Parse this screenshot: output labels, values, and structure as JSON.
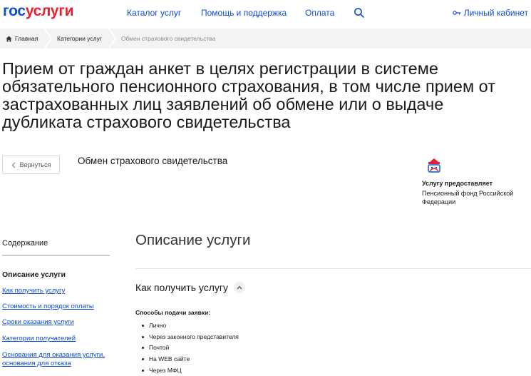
{
  "header": {
    "logo_part1": "гос",
    "logo_part2": "услуги",
    "nav": [
      "Каталог услуг",
      "Помощь и поддержка",
      "Оплата"
    ],
    "cabinet_label": "Личный кабинет"
  },
  "breadcrumb": {
    "home": "Главная",
    "category": "Категории услуг",
    "current": "Обмен страхового свидетельства"
  },
  "page": {
    "title": "Прием от граждан анкет в целях регистрации в системе обязательного пенсионного страхования, в том числе прием от застрахованных лиц заявлений об обмене или о выдаче дубликата страхового свидетельства",
    "back_label": "Вернуться",
    "service_name": "Обмен страхового свидетельства"
  },
  "provider": {
    "label": "Услугу предоставляет",
    "name": "Пенсионный фонд Российской Федерации"
  },
  "sidebar": {
    "title": "Содержание",
    "current": "Описание услуги",
    "links": [
      "Как получить услугу",
      "Стоимость и порядок оплаты",
      "Сроки оказания услуги",
      "Категории получателей",
      "Основания для оказания услуги, основания для отказа"
    ]
  },
  "main": {
    "section_title": "Описание услуги",
    "subsection_title": "Как получить услугу",
    "methods_label": "Способы подачи заявки:",
    "methods": [
      "Лично",
      "Через законного представителя",
      "Почтой",
      "На WEB сайте",
      "Через МФЦ"
    ]
  },
  "colors": {
    "brand_blue": "#0d4cd3",
    "brand_red": "#e4202a",
    "breadcrumb_bg": "#f2f3f5"
  },
  "icons": [
    "search-icon",
    "key-icon",
    "home-icon",
    "chevron-left-icon",
    "chevron-up-icon",
    "pfr-logo-icon"
  ]
}
